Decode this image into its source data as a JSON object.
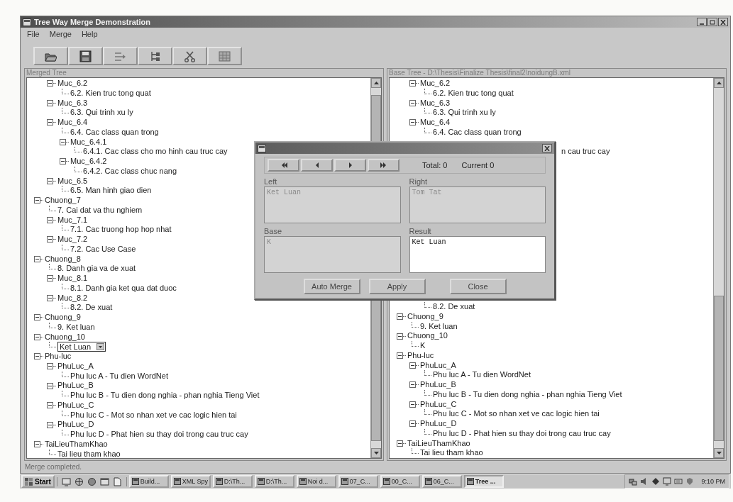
{
  "window": {
    "title": "Tree Way Merge Demonstration"
  },
  "menu": [
    {
      "label": "File"
    },
    {
      "label": "Merge"
    },
    {
      "label": "Help"
    }
  ],
  "merged_tree": {
    "title": "Merged Tree",
    "continued_children": [
      {
        "text": "Muc_6.2",
        "expanded": true,
        "children": [
          {
            "text": "6.2. Kien truc tong quat"
          }
        ]
      },
      {
        "text": "Muc_6.3",
        "expanded": true,
        "children": [
          {
            "text": "6.3. Qui trinh xu ly"
          }
        ]
      },
      {
        "text": "Muc_6.4",
        "expanded": true,
        "children": [
          {
            "text": "6.4. Cac class quan trong"
          },
          {
            "text": "Muc_6.4.1",
            "expanded": true,
            "children": [
              {
                "text": "6.4.1. Cac class cho mo hinh cau truc cay"
              }
            ]
          },
          {
            "text": "Muc_6.4.2",
            "expanded": true,
            "children": [
              {
                "text": "6.4.2. Cac class chuc nang"
              }
            ]
          }
        ]
      },
      {
        "text": "Muc_6.5",
        "expanded": true,
        "children": [
          {
            "text": "6.5. Man hinh giao dien"
          }
        ]
      }
    ],
    "nodes": [
      {
        "text": "Chuong_7",
        "expanded": true,
        "children": [
          {
            "text": "7. Cai dat va thu nghiem"
          },
          {
            "text": "Muc_7.1",
            "expanded": true,
            "children": [
              {
                "text": "7.1. Cac truong hop hop nhat"
              }
            ]
          },
          {
            "text": "Muc_7.2",
            "expanded": true,
            "children": [
              {
                "text": "7.2. Cac Use Case"
              }
            ]
          }
        ]
      },
      {
        "text": "Chuong_8",
        "expanded": true,
        "children": [
          {
            "text": "8. Danh gia va de xuat"
          },
          {
            "text": "Muc_8.1",
            "expanded": true,
            "children": [
              {
                "text": "8.1. Danh gia ket qua dat duoc"
              }
            ]
          },
          {
            "text": "Muc_8.2",
            "expanded": true,
            "children": [
              {
                "text": "8.2. De xuat"
              }
            ]
          }
        ]
      },
      {
        "text": "Chuong_9",
        "expanded": true,
        "children": [
          {
            "text": "9. Ket luan"
          }
        ]
      },
      {
        "text": "Chuong_10",
        "expanded": true,
        "children": [
          {
            "kind": "editor",
            "text": "Ket Luan"
          }
        ]
      },
      {
        "text": "Phu-luc",
        "expanded": true,
        "children": [
          {
            "text": "PhuLuc_A",
            "expanded": true,
            "children": [
              {
                "text": "Phu luc A - Tu dien WordNet"
              }
            ]
          },
          {
            "text": "PhuLuc_B",
            "expanded": true,
            "children": [
              {
                "text": "Phu luc B - Tu dien dong nghia - phan nghia Tieng Viet"
              }
            ]
          },
          {
            "text": "PhuLuc_C",
            "expanded": true,
            "children": [
              {
                "text": "Phu luc C - Mot so nhan xet ve cac logic hien tai"
              }
            ]
          },
          {
            "text": "PhuLuc_D",
            "expanded": true,
            "children": [
              {
                "text": "Phu luc D - Phat hien su thay doi trong cau truc cay"
              }
            ]
          }
        ]
      },
      {
        "text": "TaiLieuThamKhao",
        "expanded": true,
        "children": [
          {
            "text": "Tai lieu tham khao"
          }
        ]
      }
    ]
  },
  "base_tree": {
    "title": "Base Tree - D:\\Thesis\\Finalize Thesis\\final2\\noidungB.xml",
    "top_children": [
      {
        "text": "Muc_6.2",
        "expanded": true,
        "children": [
          {
            "text": "6.2. Kien truc tong quat"
          }
        ]
      },
      {
        "text": "Muc_6.3",
        "expanded": true,
        "children": [
          {
            "text": "6.3. Qui trinh xu ly"
          }
        ]
      },
      {
        "text": "Muc_6.4",
        "expanded": true,
        "children": [
          {
            "text": "6.4. Cac class quan trong"
          }
        ]
      }
    ],
    "covered_fragment": "n cau truc cay",
    "bottom_leaves": [
      "8.2. De xuat"
    ],
    "bottom_nodes": [
      {
        "text": "Chuong_9",
        "expanded": true,
        "children": [
          {
            "text": "9. Ket luan"
          }
        ]
      },
      {
        "text": "Chuong_10",
        "expanded": true,
        "children": [
          {
            "text": "K"
          }
        ]
      },
      {
        "text": "Phu-luc",
        "expanded": true,
        "children": [
          {
            "text": "PhuLuc_A",
            "expanded": true,
            "children": [
              {
                "text": "Phu luc A - Tu dien WordNet"
              }
            ]
          },
          {
            "text": "PhuLuc_B",
            "expanded": true,
            "children": [
              {
                "text": "Phu luc B - Tu dien dong nghia - phan nghia Tieng Viet"
              }
            ]
          },
          {
            "text": "PhuLuc_C",
            "expanded": true,
            "children": [
              {
                "text": "Phu luc C - Mot so nhan xet ve cac logic hien tai"
              }
            ]
          },
          {
            "text": "PhuLuc_D",
            "expanded": true,
            "children": [
              {
                "text": "Phu luc D - Phat hien su thay doi trong cau truc cay"
              }
            ]
          }
        ]
      },
      {
        "text": "TaiLieuThamKhao",
        "expanded": true,
        "children": [
          {
            "text": "Tai lieu tham khao"
          }
        ]
      }
    ]
  },
  "dialog": {
    "total": "Total: 0",
    "current": "Current 0",
    "fields": [
      {
        "label": "Left",
        "value": "Ket Luan",
        "disabled": true
      },
      {
        "label": "Right",
        "value": "Tom Tat",
        "disabled": true
      },
      {
        "label": "Base",
        "value": "K",
        "disabled": true
      },
      {
        "label": "Result",
        "value": "Ket Luan",
        "disabled": false
      }
    ],
    "buttons": [
      "Auto Merge",
      "Apply",
      "Close"
    ]
  },
  "status_bar": "Merge completed.",
  "taskbar": {
    "start": "Start",
    "tasks": [
      {
        "label": "Build...",
        "selected": false
      },
      {
        "label": "XML Spy",
        "selected": false
      },
      {
        "label": "D:\\Th...",
        "selected": false
      },
      {
        "label": "D:\\Th...",
        "selected": false
      },
      {
        "label": "Noi d...",
        "selected": false
      },
      {
        "label": "07_C...",
        "selected": false
      },
      {
        "label": "00_C...",
        "selected": false
      },
      {
        "label": "06_C...",
        "selected": false
      },
      {
        "label": "Tree ...",
        "selected": true
      }
    ],
    "clock": "9:10 PM"
  }
}
